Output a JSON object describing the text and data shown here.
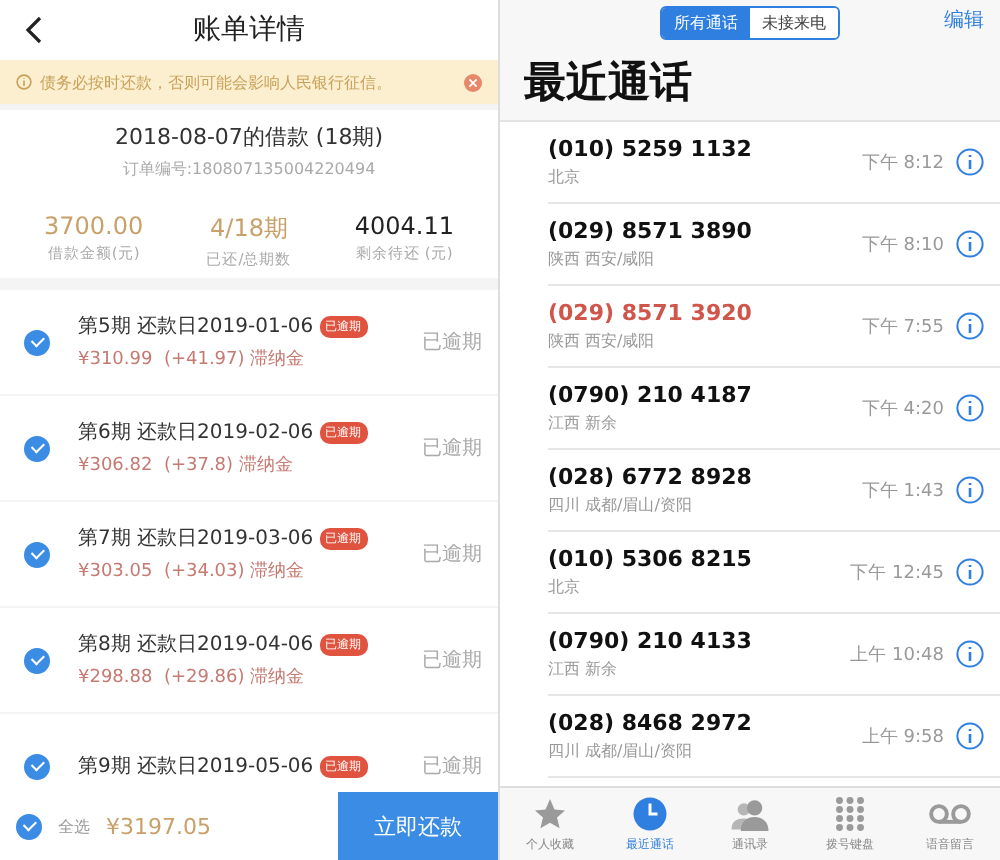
{
  "bill": {
    "title": "账单详情",
    "notice": "债务必按时还款，否则可能会影响人民银行征信。",
    "loan_title": "2018-08-07的借款 (18期)",
    "order_no": "订单编号:180807135004220494",
    "stats": [
      {
        "value": "3700.00",
        "label": "借款金额(元)",
        "kind": "accent"
      },
      {
        "value": "4/18期",
        "label": "已还/总期数",
        "kind": "accent"
      },
      {
        "value": "4004.11",
        "label": "剩余待还 (元)",
        "kind": "plain"
      }
    ],
    "installments": [
      {
        "title": "第5期 还款日2019-01-06",
        "badge": "已逾期",
        "amount": "¥310.99  (+41.97) 滞纳金",
        "status": "已逾期",
        "checked": true
      },
      {
        "title": "第6期 还款日2019-02-06",
        "badge": "已逾期",
        "amount": "¥306.82  (+37.8) 滞纳金",
        "status": "已逾期",
        "checked": true
      },
      {
        "title": "第7期 还款日2019-03-06",
        "badge": "已逾期",
        "amount": "¥303.05  (+34.03) 滞纳金",
        "status": "已逾期",
        "checked": true
      },
      {
        "title": "第8期 还款日2019-04-06",
        "badge": "已逾期",
        "amount": "¥298.88  (+29.86) 滞纳金",
        "status": "已逾期",
        "checked": true
      },
      {
        "title": "第9期 还款日2019-05-06",
        "badge": "已逾期",
        "status": "已逾期",
        "checked": true
      }
    ],
    "footer": {
      "select_all": "全选",
      "select_all_checked": true,
      "total": "¥3197.05",
      "pay_button": "立即还款"
    }
  },
  "recents": {
    "segments": [
      {
        "label": "所有通话",
        "selected": true
      },
      {
        "label": "未接来电",
        "selected": false
      }
    ],
    "edit": "编辑",
    "title": "最近通话",
    "calls": [
      {
        "number": "(010) 5259 1132",
        "location": "北京",
        "time": "下午 8:12",
        "missed": false
      },
      {
        "number": "(029) 8571 3890",
        "location": "陕西 西安/咸阳",
        "time": "下午 8:10",
        "missed": false
      },
      {
        "number": "(029) 8571 3920",
        "location": "陕西 西安/咸阳",
        "time": "下午 7:55",
        "missed": true
      },
      {
        "number": "(0790) 210 4187",
        "location": "江西 新余",
        "time": "下午 4:20",
        "missed": false
      },
      {
        "number": "(028) 6772 8928",
        "location": "四川 成都/眉山/资阳",
        "time": "下午 1:43",
        "missed": false
      },
      {
        "number": "(010) 5306 8215",
        "location": "北京",
        "time": "下午 12:45",
        "missed": false
      },
      {
        "number": "(0790) 210 4133",
        "location": "江西 新余",
        "time": "上午 10:48",
        "missed": false
      },
      {
        "number": "(028) 8468 2972",
        "location": "四川 成都/眉山/资阳",
        "time": "上午 9:58",
        "missed": false
      }
    ],
    "tabs": [
      {
        "label": "个人收藏",
        "kind": "star",
        "selected": false
      },
      {
        "label": "最近通话",
        "kind": "clock",
        "selected": true
      },
      {
        "label": "通讯录",
        "kind": "contacts",
        "selected": false
      },
      {
        "label": "拨号键盘",
        "kind": "keypad",
        "selected": false
      },
      {
        "label": "语音留言",
        "kind": "voicemail",
        "selected": false
      }
    ]
  }
}
